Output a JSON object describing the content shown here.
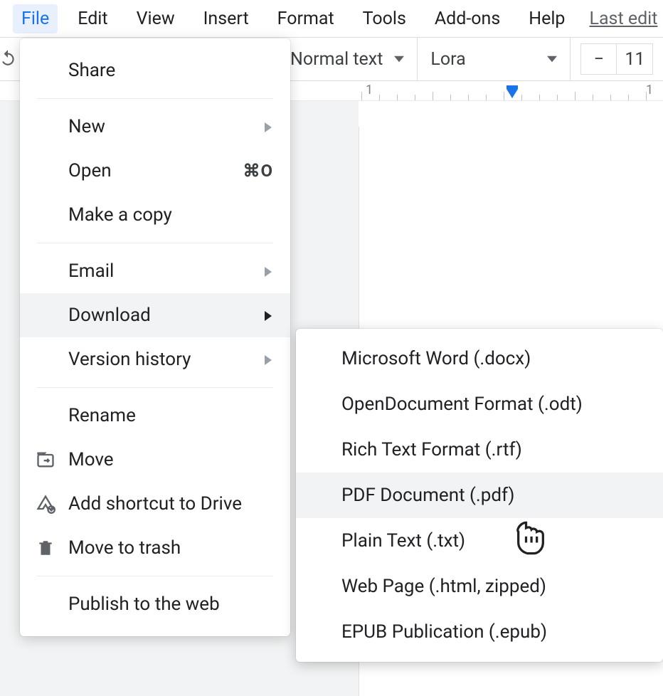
{
  "menubar": {
    "items": [
      "File",
      "Edit",
      "View",
      "Insert",
      "Format",
      "Tools",
      "Add-ons",
      "Help"
    ],
    "lastedit": "Last edit"
  },
  "toolbar": {
    "style": "Normal text",
    "font": "Lora",
    "minus": "−",
    "size": "11"
  },
  "ruler": {
    "n1": "1"
  },
  "file_menu": {
    "share": "Share",
    "new": "New",
    "open": "Open",
    "open_shortcut": "⌘O",
    "make_copy": "Make a copy",
    "email": "Email",
    "download": "Download",
    "version_history": "Version history",
    "rename": "Rename",
    "move": "Move",
    "add_shortcut": "Add shortcut to Drive",
    "move_trash": "Move to trash",
    "publish": "Publish to the web"
  },
  "download_submenu": {
    "docx": "Microsoft Word (.docx)",
    "odt": "OpenDocument Format (.odt)",
    "rtf": "Rich Text Format (.rtf)",
    "pdf": "PDF Document (.pdf)",
    "txt": "Plain Text (.txt)",
    "html": "Web Page (.html, zipped)",
    "epub": "EPUB Publication (.epub)"
  }
}
